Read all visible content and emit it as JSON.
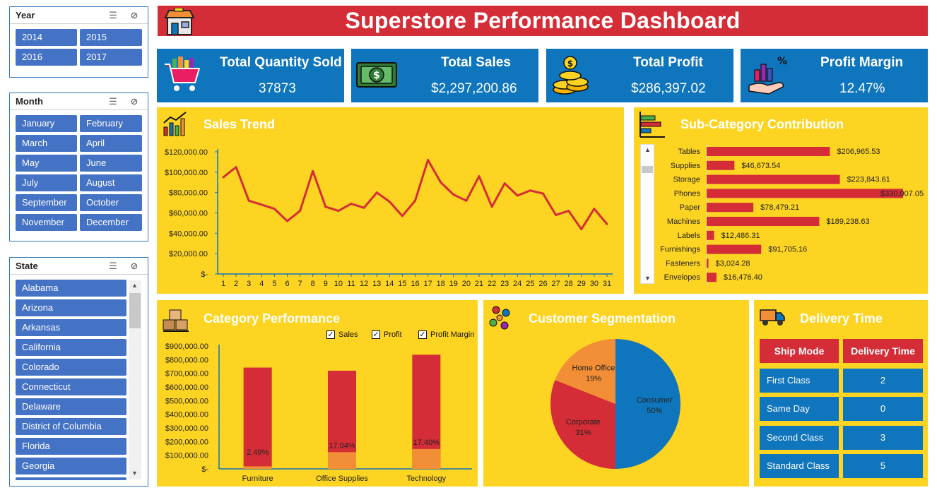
{
  "title": "Superstore Performance Dashboard",
  "slicers": {
    "year": {
      "title": "Year",
      "items": [
        "2014",
        "2015",
        "2016",
        "2017"
      ]
    },
    "month": {
      "title": "Month",
      "items": [
        "January",
        "February",
        "March",
        "April",
        "May",
        "June",
        "July",
        "August",
        "September",
        "October",
        "November",
        "December"
      ]
    },
    "state": {
      "title": "State",
      "items": [
        "Alabama",
        "Arizona",
        "Arkansas",
        "California",
        "Colorado",
        "Connecticut",
        "Delaware",
        "District of Columbia",
        "Florida",
        "Georgia"
      ]
    }
  },
  "kpis": [
    {
      "label": "Total Quantity Sold",
      "value": "37873",
      "icon": "shopping-cart-icon"
    },
    {
      "label": "Total Sales",
      "value": "$2,297,200.86",
      "icon": "money-bill-icon"
    },
    {
      "label": "Total Profit",
      "value": "$286,397.02",
      "icon": "coins-icon"
    },
    {
      "label": "Profit Margin",
      "value": "12.47%",
      "icon": "profit-chart-hand-icon"
    }
  ],
  "panels": {
    "sales_trend": "Sales Trend",
    "subcategory": "Sub-Category Contribution",
    "category": "Category Performance",
    "segmentation": "Customer Segmentation",
    "delivery": "Delivery Time"
  },
  "chart_data": [
    {
      "type": "line",
      "title": "Sales Trend",
      "x": [
        1,
        2,
        3,
        4,
        5,
        6,
        7,
        8,
        9,
        10,
        11,
        12,
        13,
        14,
        15,
        16,
        17,
        18,
        19,
        20,
        21,
        22,
        23,
        24,
        25,
        26,
        27,
        28,
        29,
        30,
        31
      ],
      "series": [
        {
          "values": [
            95000,
            105000,
            72000,
            68000,
            64000,
            52000,
            62000,
            101000,
            66000,
            62000,
            69000,
            65000,
            80000,
            71000,
            57000,
            72000,
            112000,
            90000,
            78000,
            72000,
            96000,
            66000,
            89000,
            77000,
            82000,
            79000,
            58000,
            62000,
            44000,
            64000,
            49000
          ]
        }
      ],
      "ylim": [
        0,
        120000
      ],
      "yticks": [
        "$-",
        "$20,000.00",
        "$40,000.00",
        "$60,000.00",
        "$80,000.00",
        "$100,000.00",
        "$120,000.00"
      ],
      "color": "#d42d37"
    },
    {
      "type": "bar",
      "title": "Sub-Category Contribution",
      "categories": [
        "Tables",
        "Supplies",
        "Storage",
        "Phones",
        "Paper",
        "Machines",
        "Labels",
        "Furnishings",
        "Fasteners",
        "Envelopes"
      ],
      "values": [
        206965.53,
        46673.54,
        223843.61,
        330007.05,
        78479.21,
        189238.63,
        12486.31,
        91705.16,
        3024.28,
        16476.4
      ],
      "labels": [
        "$206,965.53",
        "$46,673.54",
        "$223,843.61",
        "$330,007.05",
        "$78,479.21",
        "$189,238.63",
        "$12,486.31",
        "$91,705.16",
        "$3,024.28",
        "$16,476.40"
      ],
      "color": "#d42d37"
    },
    {
      "type": "bar",
      "title": "Category Performance",
      "categories": [
        "Furniture",
        "Office Supplies",
        "Technology"
      ],
      "series": [
        {
          "name": "Sales",
          "values": [
            742000,
            719000,
            836000
          ],
          "color": "#d42d37"
        },
        {
          "name": "Profit",
          "values": [
            18500,
            122500,
            145500
          ],
          "color": "#f28e35"
        },
        {
          "name": "Profit Margin",
          "values": [
            2.49,
            17.04,
            17.4
          ],
          "labels": [
            "2.49%",
            "17.04%",
            "17.40%"
          ]
        }
      ],
      "ylim": [
        0,
        900000
      ],
      "yticks": [
        "$-",
        "$100,000.00",
        "$200,000.00",
        "$300,000.00",
        "$400,000.00",
        "$500,000.00",
        "$600,000.00",
        "$700,000.00",
        "$800,000.00",
        "$900,000.00"
      ]
    },
    {
      "type": "pie",
      "title": "Customer Segmentation",
      "slices": [
        {
          "name": "Consumer",
          "pct": 50,
          "label": "50%",
          "color": "#0f75bc"
        },
        {
          "name": "Corporate",
          "pct": 31,
          "label": "31%",
          "color": "#d42d37"
        },
        {
          "name": "Home Office",
          "pct": 19,
          "label": "19%",
          "color": "#f28e35"
        }
      ]
    },
    {
      "type": "table",
      "title": "Delivery Time",
      "headers": [
        "Ship Mode",
        "Delivery Time"
      ],
      "rows": [
        [
          "First Class",
          "2"
        ],
        [
          "Same Day",
          "0"
        ],
        [
          "Second Class",
          "3"
        ],
        [
          "Standard Class",
          "5"
        ]
      ]
    }
  ]
}
